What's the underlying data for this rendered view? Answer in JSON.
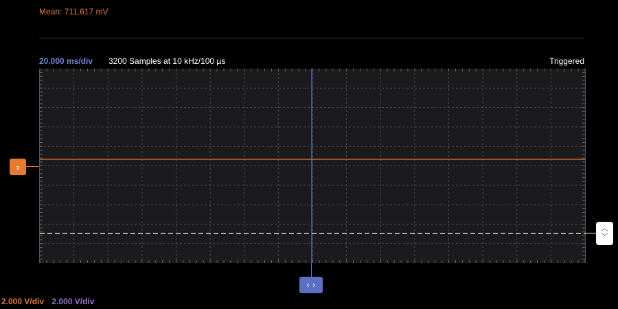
{
  "measurement": {
    "label": "Mean: 711.617 mV"
  },
  "header": {
    "timebase": "20.000 ms/div",
    "acquisition": "3200 Samples at 10 kHz/100 µs",
    "trigger_status": "Triggered"
  },
  "markers": {
    "channel_icon": "chevron-right-icon",
    "trigger_up_icon": "chevron-up-icon",
    "trigger_down_icon": "chevron-down-icon",
    "horizontal_icon": "chevron-left-right-icon"
  },
  "footer": {
    "channel_a_scale": "2.000 V/div",
    "channel_b_scale": "2.000 V/div"
  },
  "colors": {
    "background": "#000000",
    "plot_background": "#1b1b1d",
    "channel_a": "#e8792f",
    "channel_b": "#9a72d2",
    "timebase": "#6f86d6",
    "time_cursor": "#5b7be0",
    "trigger_level": "#ffffff",
    "grid": "#4a4a4e"
  }
}
